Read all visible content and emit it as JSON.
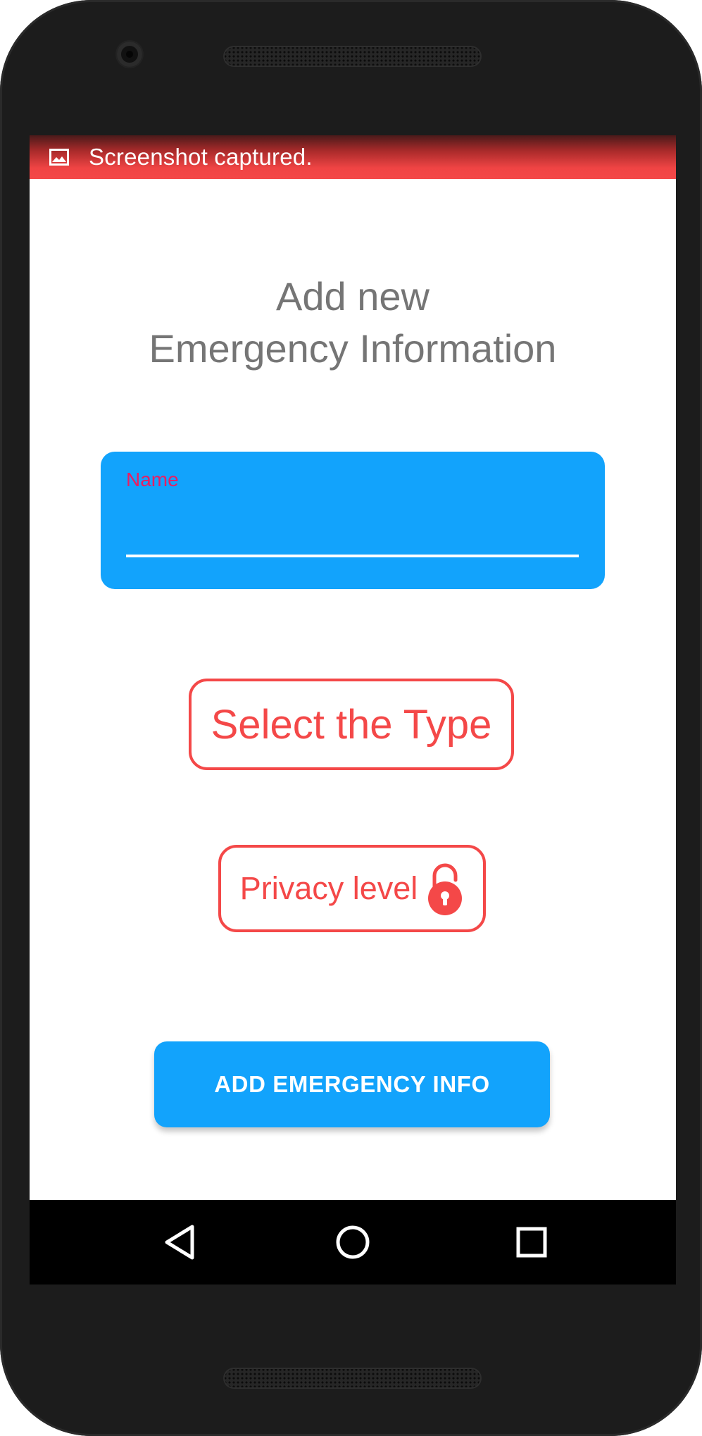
{
  "status_bar": {
    "notification_icon": "image-icon",
    "text": "Screenshot captured."
  },
  "form": {
    "title_line1": "Add new",
    "title_line2": "Emergency Information",
    "name_field": {
      "label": "Name",
      "value": ""
    },
    "type_button_label": "Select the Type",
    "privacy_button": {
      "label": "Privacy level",
      "icon": "unlock-icon"
    },
    "submit_label": "ADD EMERGENCY INFO"
  },
  "nav_bar": {
    "back_icon": "back-triangle-icon",
    "home_icon": "home-circle-icon",
    "recents_icon": "recents-square-icon"
  },
  "colors": {
    "accent_blue": "#12a3fc",
    "accent_red": "#f44848",
    "label_pink": "#e91e63",
    "title_gray": "#757575"
  }
}
